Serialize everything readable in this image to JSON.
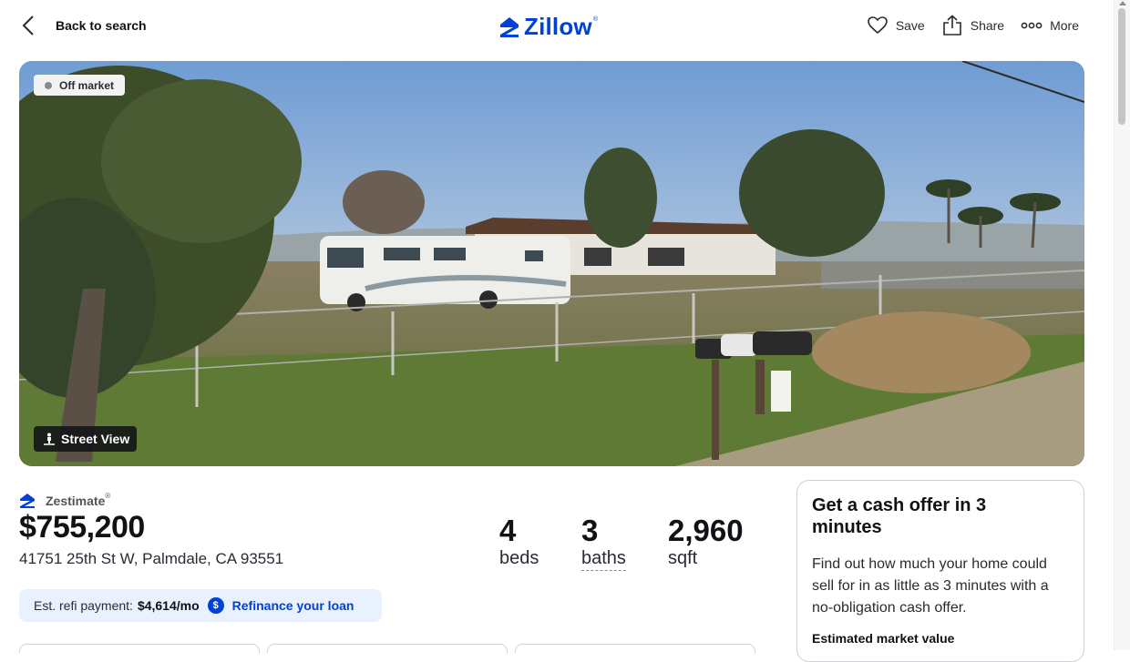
{
  "header": {
    "back_label": "Back to search",
    "logo_text": "Zillow",
    "logo_mark": "®",
    "actions": [
      {
        "icon": "heart-icon",
        "label": "Save"
      },
      {
        "icon": "share-icon",
        "label": "Share"
      },
      {
        "icon": "more-dots-icon",
        "label": "More"
      }
    ]
  },
  "hero": {
    "status_badge": "Off market",
    "street_view_label": "Street View",
    "image_subject": "street-view-photo"
  },
  "zestimate": {
    "label": "Zestimate",
    "mark": "®",
    "price": "$755,200",
    "address": "41751 25th St W, Palmdale, CA 93551"
  },
  "facts": {
    "beds": {
      "value": "4",
      "label": "beds"
    },
    "baths": {
      "value": "3",
      "label": "baths"
    },
    "sqft": {
      "value": "2,960",
      "label": "sqft"
    }
  },
  "refi": {
    "label": "Est. refi payment:",
    "amount": "$4,614/mo",
    "icon_glyph": "$",
    "link_label": "Refinance your loan"
  },
  "cash_offer": {
    "title": "Get a cash offer in 3 minutes",
    "body": "Find out how much your home could sell for in as little as 3 minutes with a no-obligation cash offer.",
    "subheading": "Estimated market value"
  },
  "colors": {
    "brand": "#0041d9",
    "refi_bg": "#e8f1fd",
    "text": "#111116"
  }
}
